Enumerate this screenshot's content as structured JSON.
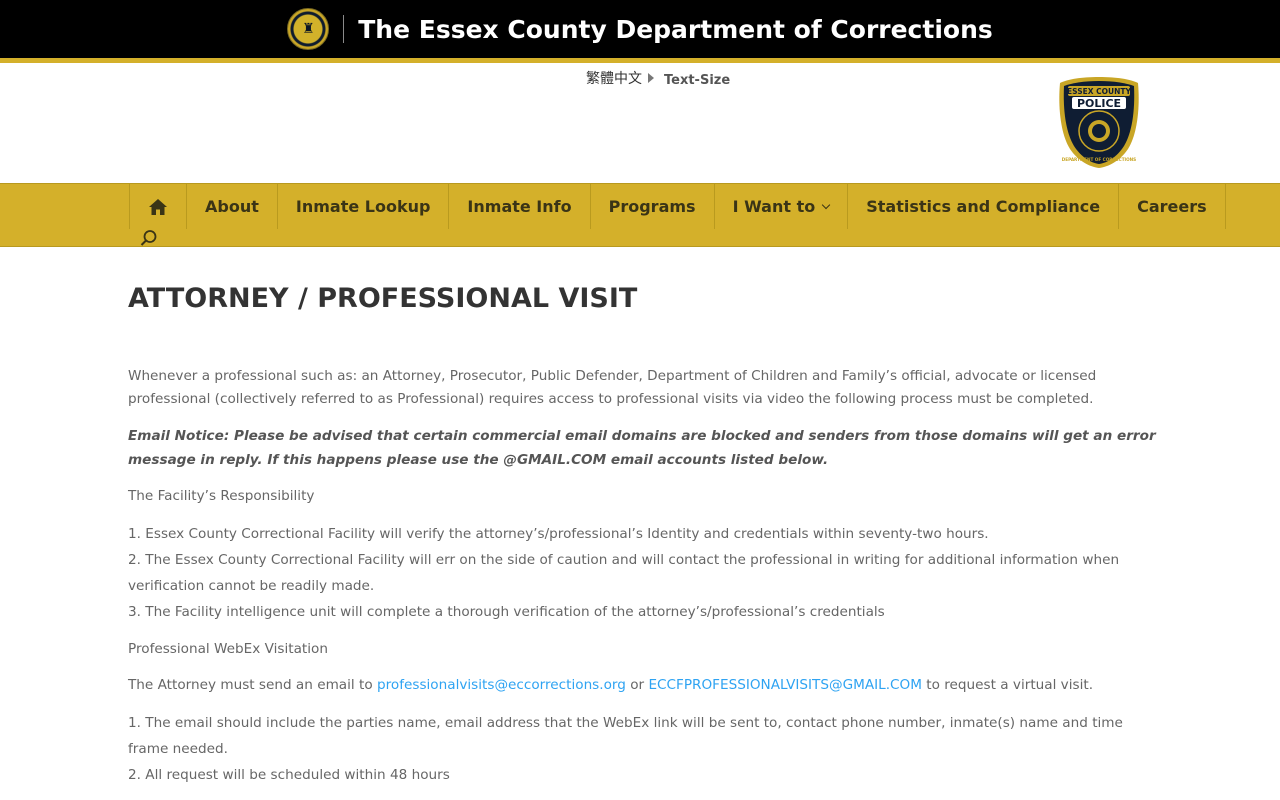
{
  "header": {
    "title": "The Essex County Department of Corrections",
    "language_link": "繁體中文",
    "text_size": "Text-Size",
    "badge": {
      "top_text": "ESSEX COUNTY",
      "middle_text": "POLICE",
      "bottom_text": "DEPARTMENT OF CORRECTIONS"
    }
  },
  "nav": {
    "items": [
      {
        "label": "About"
      },
      {
        "label": "Inmate Lookup"
      },
      {
        "label": "Inmate Info"
      },
      {
        "label": "Programs"
      },
      {
        "label": "I Want to"
      },
      {
        "label": "Statistics and Compliance"
      },
      {
        "label": "Careers"
      }
    ]
  },
  "content": {
    "title": "ATTORNEY / PROFESSIONAL VISIT",
    "intro": "Whenever a professional such as: an Attorney, Prosecutor, Public Defender, Department of Children and Family’s official, advocate or licensed professional (collectively referred to as Professional) requires access to professional visits via video the following process must be completed.",
    "notice": "Email Notice:  Please be advised that certain commercial email domains are blocked and senders from those domains will get an error message in reply.  If this happens please use the @GMAIL.COM email accounts listed below.",
    "facility_heading": "The Facility’s Responsibility",
    "facility_list": [
      "1. Essex County Correctional Facility will verify the attorney’s/professional’s Identity and credentials within seventy-two hours.",
      "2. The Essex County Correctional Facility will err on the side of caution and will contact the professional in writing for additional information when verification cannot be readily made.",
      "3. The Facility intelligence unit will complete a thorough verification of the attorney’s/professional’s credentials"
    ],
    "webex_heading": "Professional WebEx Visitation",
    "email_prefix": "The Attorney must send an email to ",
    "email_1": "professionalvisits@eccorrections.org",
    "email_or": " or ",
    "email_2": "ECCFPROFESSIONALVISITS@GMAIL.COM",
    "email_suffix": " to request a virtual visit.",
    "webex_list": [
      "1. The email should include the parties name, email address that the WebEx link will be sent to, contact phone number, inmate(s) name and time frame needed.",
      "2. All request will be scheduled within 48 hours"
    ]
  },
  "colors": {
    "topbar": "#000000",
    "gold": "#d4b02a",
    "link": "#2ea3f2",
    "heading": "#333333",
    "body_text": "#666666"
  }
}
